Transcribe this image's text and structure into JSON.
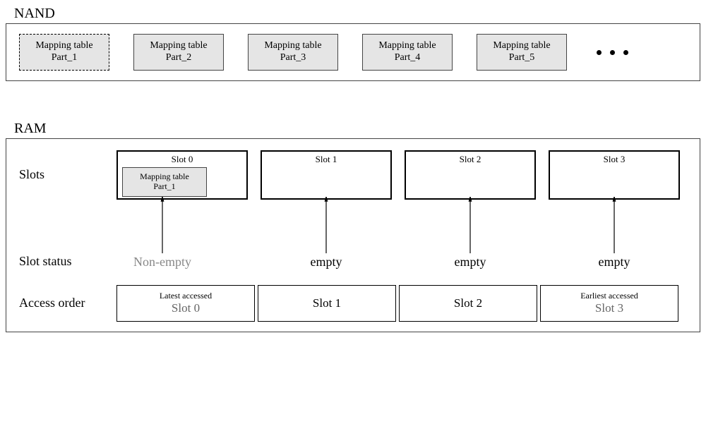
{
  "nand": {
    "label": "NAND",
    "parts": [
      {
        "line1": "Mapping table",
        "line2": "Part_1",
        "dashed": true
      },
      {
        "line1": "Mapping table",
        "line2": "Part_2",
        "dashed": false
      },
      {
        "line1": "Mapping table",
        "line2": "Part_3",
        "dashed": false
      },
      {
        "line1": "Mapping table",
        "line2": "Part_4",
        "dashed": false
      },
      {
        "line1": "Mapping table",
        "line2": "Part_5",
        "dashed": false
      }
    ]
  },
  "ram": {
    "label": "RAM",
    "row_labels": {
      "slots": "Slots",
      "status": "Slot status",
      "order": "Access order"
    },
    "slots": [
      {
        "title": "Slot 0",
        "has_mapping": true,
        "mapping": {
          "line1": "Mapping table",
          "line2": "Part_1"
        }
      },
      {
        "title": "Slot 1",
        "has_mapping": false
      },
      {
        "title": "Slot 2",
        "has_mapping": false
      },
      {
        "title": "Slot 3",
        "has_mapping": false
      }
    ],
    "status": [
      "Non-empty",
      "empty",
      "empty",
      "empty"
    ],
    "order": [
      {
        "sub": "Latest accessed",
        "main": "Slot 0"
      },
      {
        "sub": "",
        "main": "Slot 1"
      },
      {
        "sub": "",
        "main": "Slot 2"
      },
      {
        "sub": "Earliest accessed",
        "main": "Slot 3"
      }
    ]
  }
}
